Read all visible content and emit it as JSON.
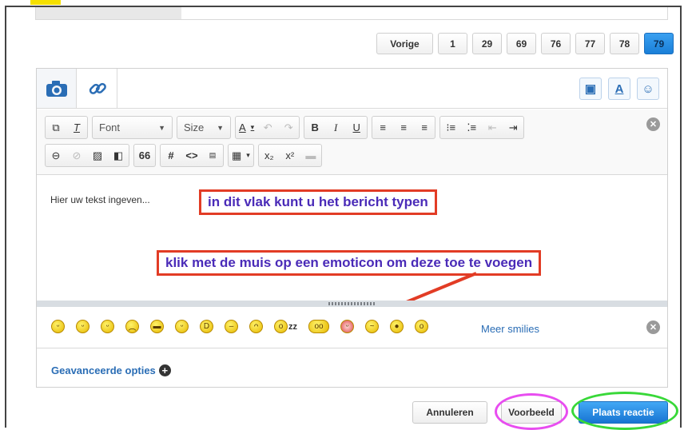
{
  "pagination": {
    "prev_label": "Vorige",
    "pages": [
      "1",
      "29",
      "69",
      "76",
      "77",
      "78",
      "79"
    ],
    "active_page": "79"
  },
  "tabs": {
    "camera_icon": "camera-icon",
    "link_icon": "link-icon"
  },
  "right_icons": [
    "clipboard-icon",
    "font-color-icon",
    "smiley-icon"
  ],
  "toolbar": {
    "font_label": "Font",
    "size_label": "Size",
    "bold": "B",
    "italic": "I",
    "underline": "U",
    "hash": "#",
    "code": "<>",
    "quote": "66",
    "subscript": "x₂",
    "superscript": "x²"
  },
  "editor": {
    "placeholder": "Hier uw tekst ingeven..."
  },
  "annotations": {
    "callout_top": "in dit vlak kunt u het bericht typen",
    "callout_bottom": "klik met de muis op een emoticon om deze toe te voegen"
  },
  "smilies": {
    "items": [
      "smile",
      "wink",
      "devil",
      "sad",
      "cool",
      "tongue",
      "laugh",
      "neutral",
      "cry",
      "sleep",
      "glasses",
      "angry-face",
      "confused",
      "dizzy",
      "shocked"
    ],
    "sleep_text": "zz",
    "more_label": "Meer smilies"
  },
  "advanced": {
    "label": "Geavanceerde opties"
  },
  "actions": {
    "cancel": "Annuleren",
    "preview": "Voorbeeld",
    "submit": "Plaats reactie"
  },
  "colors": {
    "accent_blue": "#2a6db5",
    "callout_border": "#e23c25",
    "callout_text": "#4a2bb8",
    "highlight_pink": "#e84df0",
    "highlight_green": "#38d838"
  }
}
